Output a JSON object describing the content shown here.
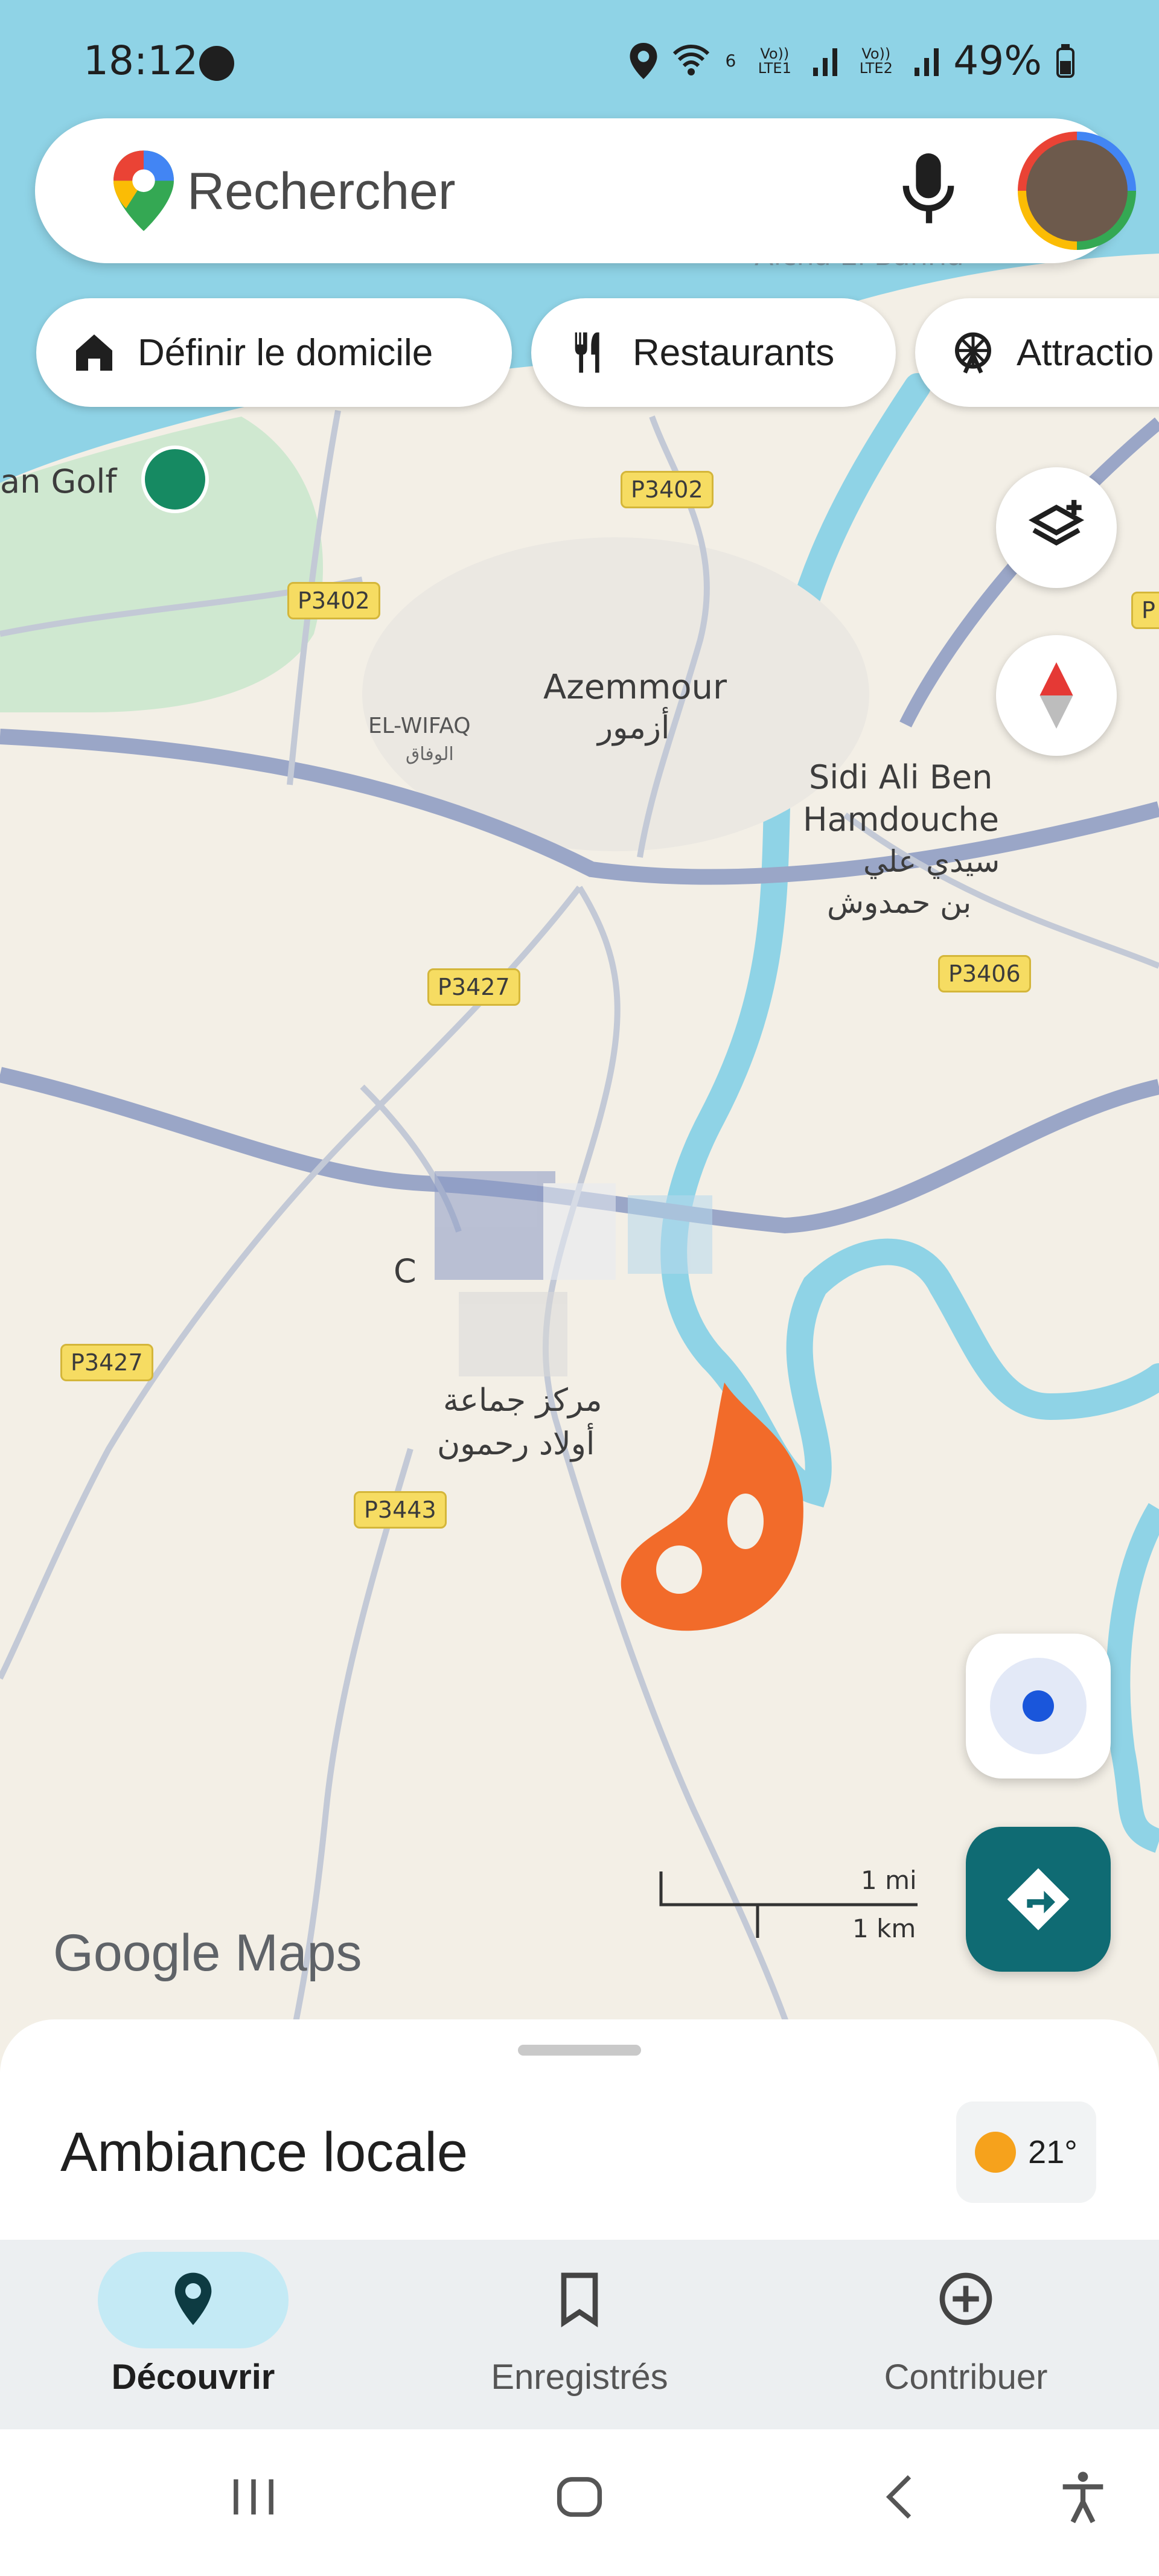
{
  "status_bar": {
    "time": "18:12",
    "battery": "49%",
    "sim1": "Vo)) LTE1",
    "sim2": "Vo)) LTE2",
    "wifi_badge": "6"
  },
  "search": {
    "placeholder": "Rechercher",
    "icons": [
      "maps-pin-icon",
      "microphone-icon",
      "account-avatar"
    ]
  },
  "chips": [
    {
      "label": "Définir le domicile",
      "icon": "home-icon"
    },
    {
      "label": "Restaurants",
      "icon": "fork-knife-icon"
    },
    {
      "label": "Attractio",
      "icon": "ferris-wheel-icon"
    }
  ],
  "map": {
    "places": {
      "azemmour": "Azemmour",
      "azemmour_ar": "أزمور",
      "el_wifaq": "EL-WIFAQ",
      "el_wifaq_ar": "الوفاق",
      "sidi_ali": "Sidi Ali Ben",
      "sidi_ali_2": "Hamdouche",
      "sidi_ali_ar": "سيدي علي",
      "sidi_ali_ar_2": "بن حمدوش",
      "golf": "an Golf",
      "center_letter": "C",
      "markaz_ar": "مركز جماعة",
      "markaz_ar_2": "أولاد رحمون",
      "top_cut": "Aïcha El Bahria"
    },
    "roads": {
      "p3402_a": "P3402",
      "p3402_b": "P3402",
      "p3427_a": "P3427",
      "p3427_b": "P3427",
      "p3406": "P3406",
      "p3443": "P3443",
      "p_edge": "P"
    },
    "scale": {
      "mi": "1 mi",
      "km": "1 km"
    },
    "brand": "Google Maps",
    "colors": {
      "land": "#f3efe6",
      "water": "#8fd3e6",
      "road": "#9aa6c7",
      "park": "#cfe8d0",
      "drawn": "#f26b2a"
    }
  },
  "sheet": {
    "title": "Ambiance locale",
    "temperature": "21°"
  },
  "bottom_nav": [
    {
      "label": "Découvrir",
      "icon": "explore-pin-icon",
      "active": true
    },
    {
      "label": "Enregistrés",
      "icon": "bookmark-icon",
      "active": false
    },
    {
      "label": "Contribuer",
      "icon": "add-circle-icon",
      "active": false
    }
  ]
}
